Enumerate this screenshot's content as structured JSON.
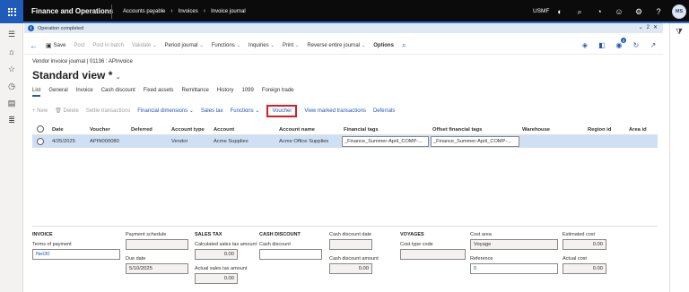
{
  "topbar": {
    "app_title": "Finance and Operations",
    "breadcrumbs": [
      "Accounts payable",
      "Invoices",
      "Invoice journal"
    ],
    "company": "USMF",
    "avatar_initials": "MS"
  },
  "message": {
    "text": "Operation completed",
    "count": "2"
  },
  "action_pane": {
    "save": "Save",
    "post": "Post",
    "post_batch": "Post in batch",
    "validate": "Validate",
    "period_journal": "Period journal",
    "functions": "Functions",
    "inquiries": "Inquiries",
    "print": "Print",
    "reverse_journal": "Reverse entire journal",
    "options": "Options",
    "notification_count": "0"
  },
  "page": {
    "breadcrumb": "Vendor invoice journal  |  01136 : APInvoice",
    "title": "Standard view *"
  },
  "tabs": [
    "List",
    "General",
    "Invoice",
    "Cash discount",
    "Fixed assets",
    "Remittance",
    "History",
    "1099",
    "Foreign trade"
  ],
  "grid_toolbar": {
    "new": "+ New",
    "delete": "Delete",
    "settle": "Settle transactions",
    "fin_dims": "Financial dimensions",
    "sales_tax": "Sales tax",
    "functions": "Functions",
    "voucher": "Voucher",
    "view_marked": "View marked transactions",
    "deferrals": "Deferrals"
  },
  "grid": {
    "columns": [
      "Date",
      "Voucher",
      "Deferred",
      "Account type",
      "Account",
      "Account name",
      "Financial tags",
      "Offset financial tags",
      "Warehouse",
      "Region id",
      "Area id"
    ],
    "row": {
      "date": "4/25/2025",
      "voucher": "APIN000080",
      "account_type": "Vendor",
      "account": "Acme Supplies",
      "account_name": "Acme Office Supplies",
      "financial_tags": "_Finance_Summer-April_COMP-...",
      "offset_financial_tags": "_Finance_Summer-April_COMP-..."
    }
  },
  "details": {
    "invoice_group": "INVOICE",
    "terms_label": "Terms of payment",
    "terms_value": "Net30",
    "payment_schedule_label": "Payment schedule",
    "due_date_label": "Due date",
    "due_date_value": "5/10/2025",
    "sales_tax_group": "SALES TAX",
    "calc_tax_label": "Calculated sales tax amount",
    "calc_tax_value": "0.00",
    "actual_tax_label": "Actual sales tax amount",
    "actual_tax_value": "0.00",
    "cash_discount_group": "CASH DISCOUNT",
    "cash_discount_label": "Cash discount",
    "cd_date_label": "Cash discount date",
    "cd_amount_label": "Cash discount amount",
    "cd_amount_value": "0.00",
    "voyages_group": "VOYAGES",
    "cost_type_label": "Cost type code",
    "cost_area_label": "Cost area",
    "cost_area_value": "Voyage",
    "reference_label": "Reference",
    "reference_value": "0",
    "estimated_cost_label": "Estimated cost",
    "estimated_cost_value": "0.00",
    "actual_cost_label": "Actual cost",
    "actual_cost_value": "0.00"
  }
}
